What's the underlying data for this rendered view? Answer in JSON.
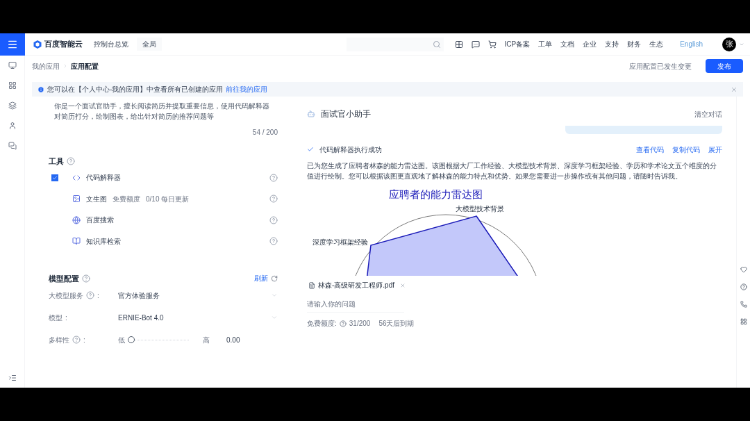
{
  "topbar": {
    "brand": "百度智能云",
    "console": "控制台总览",
    "region": "全局",
    "nav": [
      "ICP备案",
      "工单",
      "文档",
      "企业",
      "支持",
      "财务",
      "生态"
    ],
    "language": "English",
    "avatar": "张"
  },
  "breadcrumb": [
    {
      "label": "我的应用",
      "selected": false
    },
    {
      "label": "应用配置",
      "selected": true
    }
  ],
  "change_notice": "应用配置已发生变更",
  "publish_button": "发布",
  "banner": {
    "text": "您可以在【个人中心-我的应用】中查看所有已创建的应用",
    "link": "前往我的应用"
  },
  "config": {
    "description": "你是一个面试官助手，擅长阅读简历并提取重要信息，使用代码解释器对简历打分，绘制图表，给出针对简历的推荐问题等",
    "char_count": "54 / 200",
    "tools_title": "工具",
    "tools": [
      {
        "kind": "checkbox",
        "checked": true,
        "name": "代码解释器"
      },
      {
        "kind": "plain",
        "name": "文生图",
        "quota_label": "免费额度",
        "quota": "0/10 每日更新"
      },
      {
        "kind": "plain",
        "name": "百度搜索"
      },
      {
        "kind": "plain",
        "name": "知识库检索"
      }
    ],
    "model_title": "模型配置",
    "refresh": "刷新",
    "fields": [
      {
        "kind": "select",
        "label": "大模型服务",
        "help": true,
        "separator": ":",
        "value": "官方体验服务"
      },
      {
        "kind": "select",
        "label": "模型",
        "help": false,
        "separator": ":",
        "value": "ERNIE-Bot 4.0"
      },
      {
        "kind": "slider",
        "label": "多样性",
        "help": true,
        "separator": ":",
        "low": "低",
        "high": "高",
        "level": 0,
        "reading": "0.00"
      }
    ]
  },
  "chat": {
    "title": "面试官小助手",
    "clear": "清空对话",
    "status": "代码解释器执行成功",
    "actions": [
      "查看代码",
      "复制代码",
      "展开"
    ],
    "message": "已为您生成了应聘者林森的能力雷达图。该图根据大厂工作经验、大模型技术背景、深度学习框架经验、学历和学术论文五个维度的分值进行绘制。您可以根据该图更直观地了解林森的能力特点和优势。如果您需要进一步操作或有其他问题，请随时告诉我。",
    "chart_title": "应聘者的能力雷达图",
    "axis_labels": [
      "大模型技术背景",
      "深度学习框架经验"
    ],
    "attachment": "林森-高级研发工程师.pdf",
    "input_placeholder": "请输入你的问题",
    "quota_label": "免费额度:",
    "quota": "31/200",
    "expiry": "56天后到期"
  }
}
